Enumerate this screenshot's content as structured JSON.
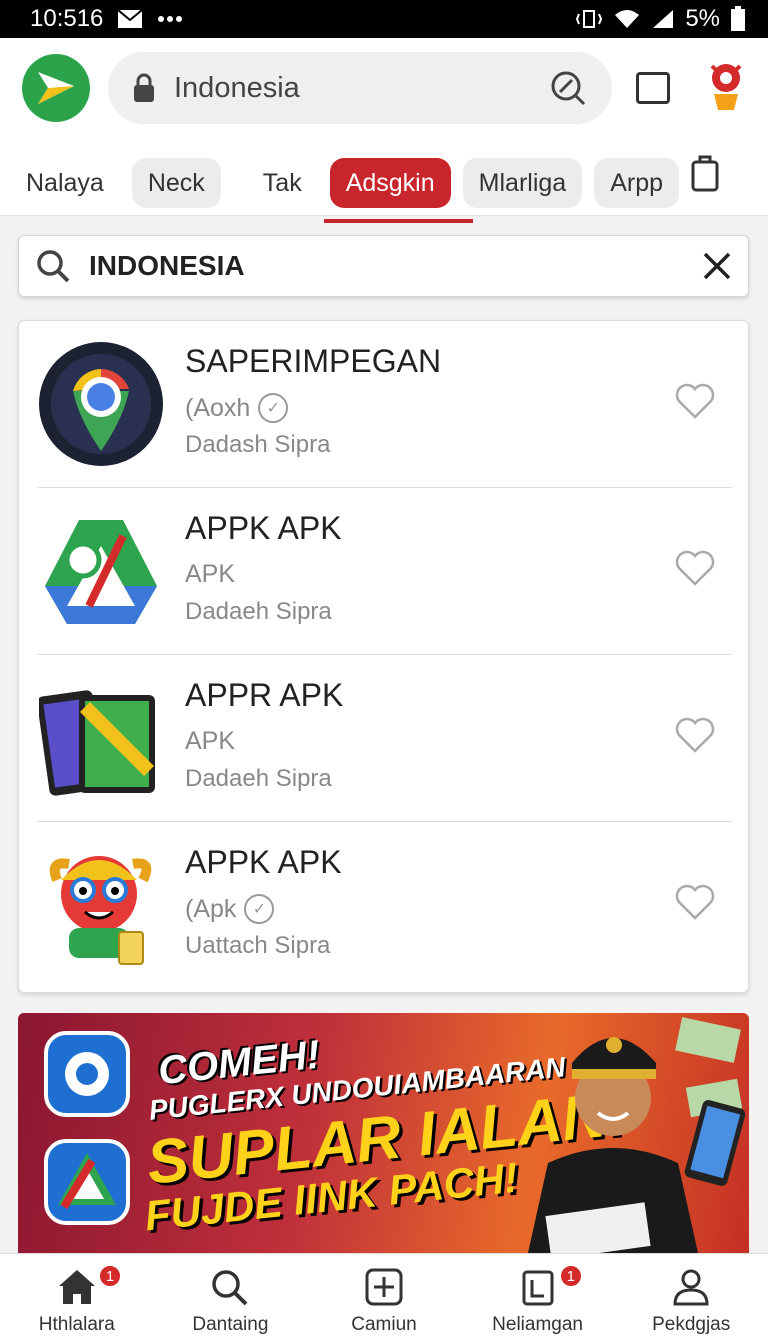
{
  "status_bar": {
    "time": "10:516",
    "battery": "5%"
  },
  "header": {
    "url": "Indonesia"
  },
  "chips": [
    {
      "label": "Nalaya"
    },
    {
      "label": "Neck"
    },
    {
      "label": "Tak"
    },
    {
      "label": "Adsgkin"
    },
    {
      "label": "Mlarliga"
    },
    {
      "label": "Arpp"
    }
  ],
  "search": {
    "value": "INDONESIA"
  },
  "results": [
    {
      "title": "SAPERIMPEGAN",
      "sub": "(Aoxh",
      "developer": "Dadash Sipra",
      "icon": "chrome-pin-icon"
    },
    {
      "title": "APPK APK",
      "sub": "APK",
      "developer": "Dadaeh Sipra",
      "icon": "drive-gear-icon"
    },
    {
      "title": "APPR APK",
      "sub": "APK",
      "developer": "Dadaeh Sipra",
      "icon": "phone-map-icon"
    },
    {
      "title": "APPK APK",
      "sub": "(Apk",
      "developer": "Uattach Sipra",
      "icon": "cartoon-mascot-icon"
    }
  ],
  "banner": {
    "line1": "COMEH!",
    "line2": "PUGLERX UNDOUIAMBAARAN",
    "line3": "SUPLAR IALAN.",
    "line4": "FUJDE IINK PACH!"
  },
  "bottom_nav": [
    {
      "label": "Hthlalara",
      "badge": "1",
      "icon": "home-icon"
    },
    {
      "label": "Dantaing",
      "badge": "",
      "icon": "search-icon"
    },
    {
      "label": "Camiun",
      "badge": "",
      "icon": "plus-box-icon"
    },
    {
      "label": "Neliamgan",
      "badge": "1",
      "icon": "notification-icon"
    },
    {
      "label": "Pekdgjas",
      "badge": "",
      "icon": "profile-icon"
    }
  ],
  "colors": {
    "accent": "#c8262c",
    "logo": "#2ca34a"
  }
}
